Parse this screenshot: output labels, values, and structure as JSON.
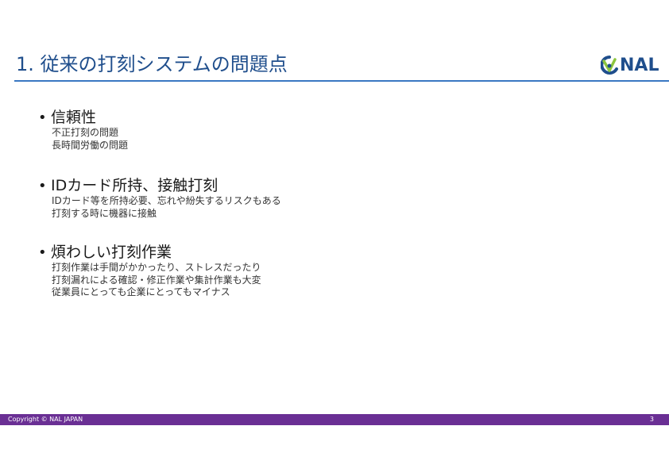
{
  "slide": {
    "title": "1. 従来の打刻システムの問題点",
    "logo_text": "NAL",
    "bullets": [
      {
        "marker": "•",
        "title": "信頼性",
        "lines": [
          "不正打刻の問題",
          "長時間労働の問題"
        ]
      },
      {
        "marker": "•",
        "title": "IDカード所持、接触打刻",
        "lines": [
          "IDカード等を所持必要、忘れや紛失するリスクもある",
          "打刻する時に機器に接触"
        ]
      },
      {
        "marker": "•",
        "title": "煩わしい打刻作業",
        "lines": [
          "打刻作業は手間がかかったり、ストレスだったり",
          "打刻漏れによる確認・修正作業や集計作業も大変",
          "従業員にとっても企業にとってもマイナス"
        ]
      }
    ]
  },
  "footer": {
    "copyright": "Copyright © NAL JAPAN",
    "page_number": "3"
  },
  "colors": {
    "title": "#1f4e8c",
    "rule": "#3a78c2",
    "footer_bar": "#6a2f94",
    "logo_blue": "#1f4e8c",
    "logo_green": "#8dc63f"
  }
}
